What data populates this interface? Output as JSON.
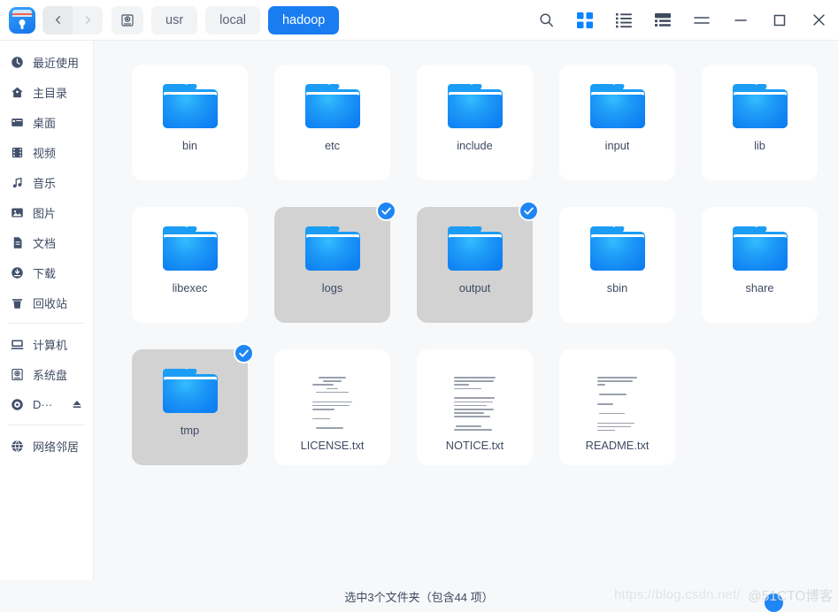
{
  "window": {
    "app_icon": "file-manager-icon"
  },
  "nav": {
    "back_icon": "chevron-left-icon",
    "forward_icon": "chevron-right-icon",
    "root_icon": "disk-icon",
    "breadcrumbs": [
      {
        "label": "usr",
        "active": false
      },
      {
        "label": "local",
        "active": false
      },
      {
        "label": "hadoop",
        "active": true
      }
    ]
  },
  "toolbar": {
    "buttons": [
      {
        "name": "search-icon",
        "icon": "search",
        "active": false
      },
      {
        "name": "icon-view-icon",
        "icon": "grid",
        "active": true
      },
      {
        "name": "list-view-icon",
        "icon": "list",
        "active": false
      },
      {
        "name": "detail-view-icon",
        "icon": "detail",
        "active": false
      },
      {
        "name": "menu-icon",
        "icon": "hamburger",
        "active": false
      },
      {
        "name": "minimize-icon",
        "icon": "minimize",
        "active": false
      },
      {
        "name": "maximize-icon",
        "icon": "maximize",
        "active": false
      },
      {
        "name": "close-icon",
        "icon": "close",
        "active": false
      }
    ]
  },
  "sidebar": {
    "groups": [
      {
        "items": [
          {
            "label": "最近使用",
            "icon": "clock-icon",
            "key": "recent"
          },
          {
            "label": "主目录",
            "icon": "home-icon",
            "key": "home"
          },
          {
            "label": "桌面",
            "icon": "desktop-icon",
            "key": "desktop"
          },
          {
            "label": "视频",
            "icon": "video-icon",
            "key": "videos"
          },
          {
            "label": "音乐",
            "icon": "music-icon",
            "key": "music"
          },
          {
            "label": "图片",
            "icon": "image-icon",
            "key": "pictures"
          },
          {
            "label": "文档",
            "icon": "document-icon",
            "key": "documents"
          },
          {
            "label": "下载",
            "icon": "download-icon",
            "key": "downloads"
          },
          {
            "label": "回收站",
            "icon": "trash-icon",
            "key": "trash"
          }
        ]
      },
      {
        "items": [
          {
            "label": "计算机",
            "icon": "computer-icon",
            "key": "computer"
          },
          {
            "label": "系统盘",
            "icon": "disk-icon",
            "key": "system-disk"
          },
          {
            "label": "D···",
            "icon": "optical-disc-icon",
            "key": "dvd-drive",
            "eject": true,
            "eject_icon": "eject-icon"
          }
        ]
      },
      {
        "items": [
          {
            "label": "网络邻居",
            "icon": "network-icon",
            "key": "network"
          }
        ]
      }
    ]
  },
  "files": [
    {
      "name": "bin",
      "type": "folder",
      "selected": false
    },
    {
      "name": "etc",
      "type": "folder",
      "selected": false
    },
    {
      "name": "include",
      "type": "folder",
      "selected": false
    },
    {
      "name": "input",
      "type": "folder",
      "selected": false
    },
    {
      "name": "lib",
      "type": "folder",
      "selected": false
    },
    {
      "name": "libexec",
      "type": "folder",
      "selected": false
    },
    {
      "name": "logs",
      "type": "folder",
      "selected": true
    },
    {
      "name": "output",
      "type": "folder",
      "selected": true
    },
    {
      "name": "sbin",
      "type": "folder",
      "selected": false
    },
    {
      "name": "share",
      "type": "folder",
      "selected": false
    },
    {
      "name": "tmp",
      "type": "folder",
      "selected": true
    },
    {
      "name": "LICENSE.txt",
      "type": "text",
      "selected": false,
      "preview": "centered"
    },
    {
      "name": "NOTICE.txt",
      "type": "text",
      "selected": false,
      "preview": "paragraph"
    },
    {
      "name": "README.txt",
      "type": "text",
      "selected": false,
      "preview": "sparse"
    }
  ],
  "status": {
    "text": "选中3个文件夹（包含44 项）"
  },
  "watermarks": {
    "url": "https://blog.csdn.net/",
    "brand": "@51CTO博客"
  },
  "colors": {
    "accent": "#197cf1",
    "folder_blue": "#1b9cf5",
    "selected_bg": "#d2d2d2",
    "check_blue": "#1f86f5",
    "canvas": "#f7f8fa",
    "text": "#3f4a63"
  }
}
